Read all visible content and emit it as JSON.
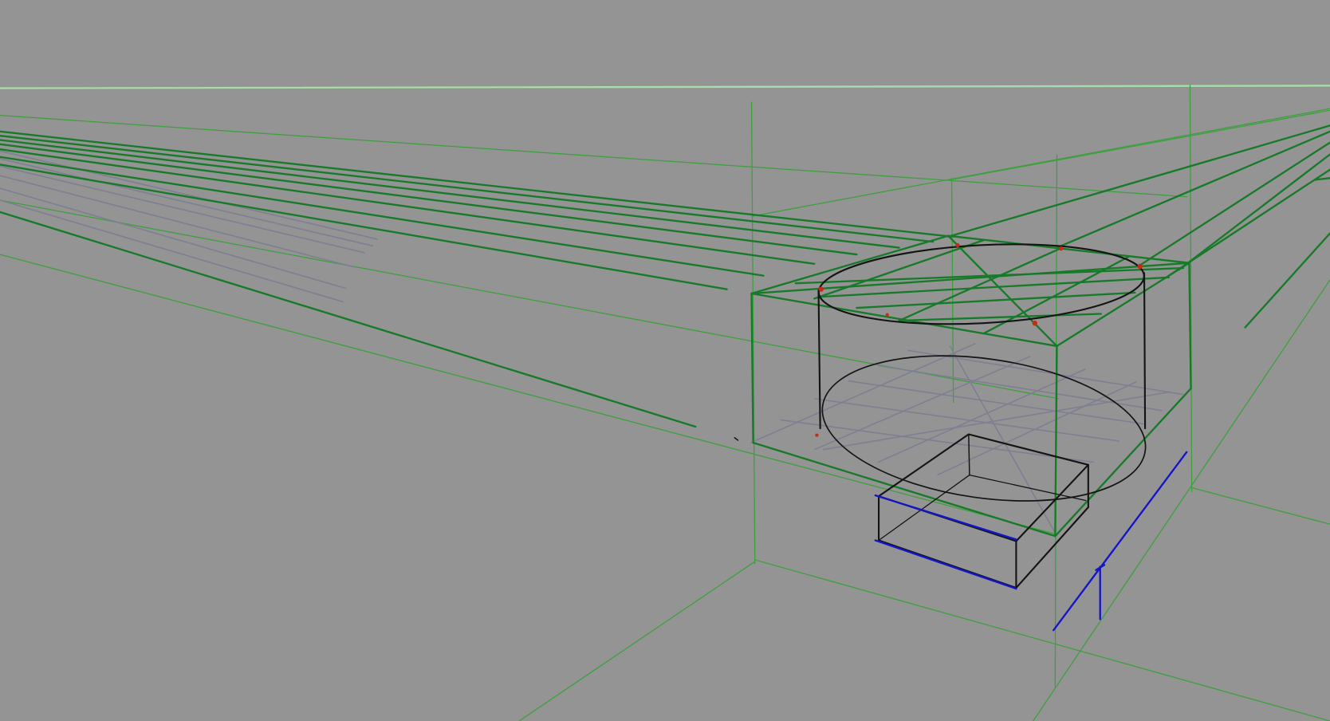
{
  "canvas": {
    "background": "#949494"
  },
  "colors": {
    "horizon": "#a8dca8",
    "guide": "#3da03d",
    "construction": "#167a28",
    "grid": "#7e7f92",
    "ink": "#141414",
    "accent": "#1515c8",
    "marker": "#cc2a10"
  }
}
